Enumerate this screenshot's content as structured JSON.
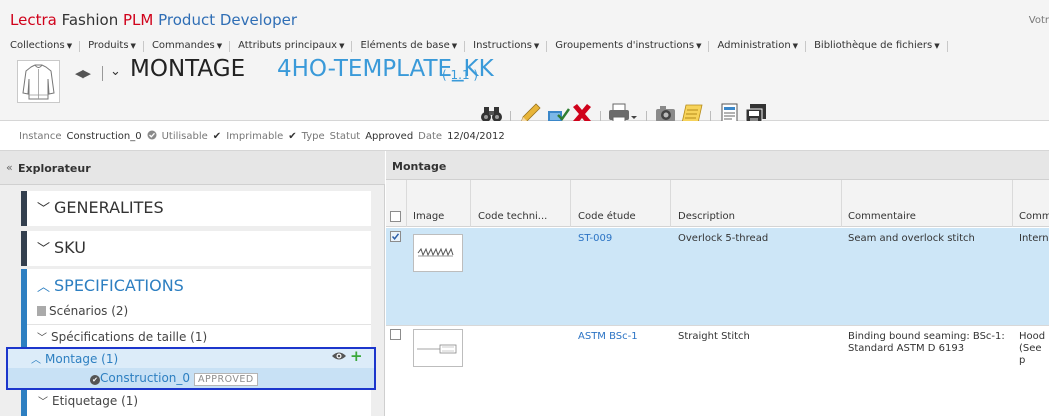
{
  "app": {
    "brand_lectra": "Lectra",
    "brand_fashion": "Fashion",
    "brand_plm": "PLM",
    "brand_product": "Product Developer",
    "user_truncated": "Votr"
  },
  "menu": [
    {
      "label": "Collections"
    },
    {
      "label": "Produits"
    },
    {
      "label": "Commandes"
    },
    {
      "label": "Attributs principaux"
    },
    {
      "label": "Eléments de base"
    },
    {
      "label": "Instructions"
    },
    {
      "label": "Groupements d'instructions"
    },
    {
      "label": "Administration"
    },
    {
      "label": "Bibliothèque de fichiers"
    }
  ],
  "title": {
    "nav_arrows": "◀▶",
    "type": "MONTAGE",
    "name": "4HO-TEMPLATE_KK",
    "version": "( 1.1 )"
  },
  "toolbar": {
    "icons": [
      "binoculars-icon",
      "pencil-icon",
      "check-out-icon",
      "delete-icon",
      "print-icon",
      "camera-icon",
      "notes-icon",
      "document-icon",
      "save-as-icon"
    ]
  },
  "status": {
    "instance_label": "Instance",
    "instance_value": "Construction_0",
    "usable_label": "Utilisable",
    "printable_label": "Imprimable",
    "type_label": "Type",
    "status_label": "Statut",
    "status_value": "Approved",
    "date_label": "Date",
    "date_value": "12/04/2012"
  },
  "explorer": {
    "collapse_glyph": "«",
    "title": "Explorateur",
    "sections": {
      "generalites": "GENERALITES",
      "sku": "SKU",
      "specifications": "SPECIFICATIONS"
    },
    "tree": {
      "scenarios": "Scénarios (2)",
      "size_specs": "Spécifications de taille (1)",
      "montage": "Montage (1)",
      "construction": "Construction_0",
      "construction_badge": "APPROVED",
      "etiquetage": "Etiquetage (1)"
    }
  },
  "main": {
    "title": "Montage",
    "columns": [
      "Image",
      "Code techni...",
      "Code étude",
      "Description",
      "Commentaire",
      "Comm"
    ],
    "rows": [
      {
        "checked": true,
        "code_etude": "ST-009",
        "description": "Overlock 5-thread",
        "commentaire": "Seam and overlock stitch",
        "comm": "Intern"
      },
      {
        "checked": false,
        "code_etude": "ASTM BSc-1",
        "description": "Straight Stitch",
        "commentaire_line1": "Binding bound seaming: BSc-1:",
        "commentaire_line2": "Standard ASTM D 6193",
        "comm_line1": "Hood",
        "comm_line2": "(See p"
      }
    ]
  }
}
